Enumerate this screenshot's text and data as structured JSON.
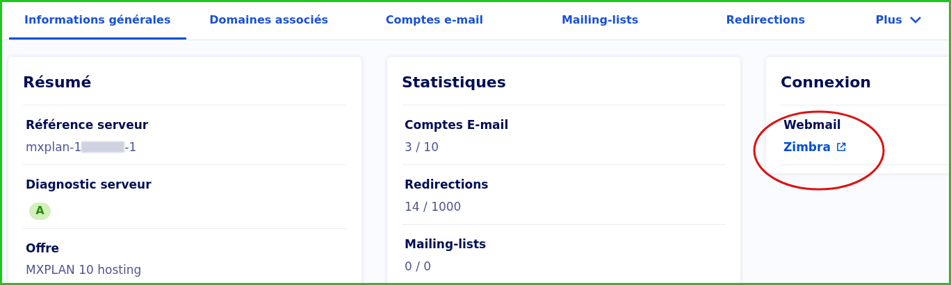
{
  "tabs": [
    {
      "label": "Informations générales",
      "selected": true
    },
    {
      "label": "Domaines associés",
      "selected": false
    },
    {
      "label": "Comptes e-mail",
      "selected": false
    },
    {
      "label": "Mailing-lists",
      "selected": false
    },
    {
      "label": "Redirections",
      "selected": false
    },
    {
      "label": "Plus",
      "selected": false,
      "kind": "dropdown"
    }
  ],
  "cards": [
    {
      "title": "Résumé",
      "rows": [
        {
          "label": "Référence serveur",
          "kind": "redacted",
          "value_start": "mxplan-1",
          "value_end": "-1"
        },
        {
          "label": "Diagnostic serveur",
          "kind": "badge",
          "value": "A"
        },
        {
          "label": "Offre",
          "kind": "text",
          "value": "MXPLAN 10 hosting"
        }
      ]
    },
    {
      "title": "Statistiques",
      "rows": [
        {
          "label": "Comptes E-mail",
          "kind": "text",
          "value": "3 / 10"
        },
        {
          "label": "Redirections",
          "kind": "text",
          "value": "14 / 1000"
        },
        {
          "label": "Mailing-lists",
          "kind": "text",
          "value": "0 / 0"
        }
      ]
    },
    {
      "title": "Connexion",
      "highlighted": true,
      "rows": [
        {
          "label": "Webmail",
          "kind": "link",
          "value": "Zimbra"
        }
      ]
    }
  ]
}
